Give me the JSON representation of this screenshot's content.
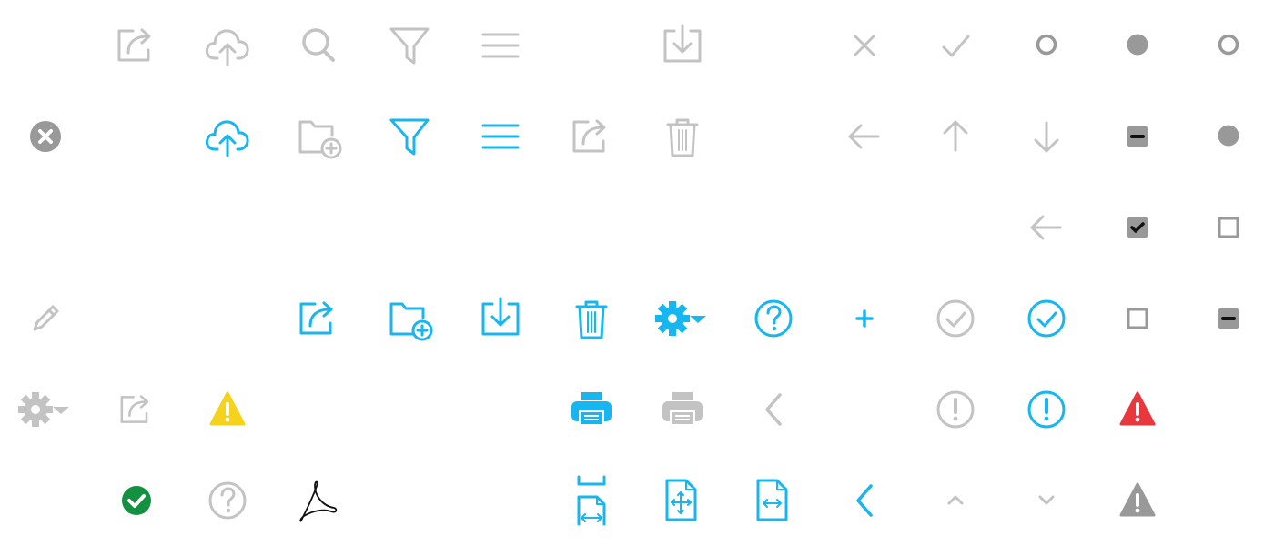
{
  "colors": {
    "gray": "#c3c3c3",
    "dark_gray": "#999999",
    "blue": "#18b6f0",
    "black": "#111111",
    "yellow": "#f5d31c",
    "red": "#e8383d",
    "green": "#149140",
    "white": "#ffffff"
  },
  "icons": [
    {
      "name": "share-icon",
      "tone": "gray"
    },
    {
      "name": "cloud-upload-icon",
      "tone": "gray"
    },
    {
      "name": "search-icon",
      "tone": "gray"
    },
    {
      "name": "filter-icon",
      "tone": "gray"
    },
    {
      "name": "menu-icon",
      "tone": "gray"
    },
    {
      "name": "download-icon",
      "tone": "gray"
    },
    {
      "name": "close-icon",
      "tone": "gray"
    },
    {
      "name": "check-icon",
      "tone": "gray"
    },
    {
      "name": "radio-unselected-icon",
      "tone": "dark_gray"
    },
    {
      "name": "dot-filled-icon",
      "tone": "dark_gray"
    },
    {
      "name": "radio-unselected-icon",
      "tone": "dark_gray"
    },
    {
      "name": "close-circle-icon",
      "tone": "dark_gray"
    },
    {
      "name": "cloud-upload-icon",
      "tone": "blue"
    },
    {
      "name": "folder-add-icon",
      "tone": "gray"
    },
    {
      "name": "filter-icon",
      "tone": "blue"
    },
    {
      "name": "menu-icon",
      "tone": "blue"
    },
    {
      "name": "share-icon",
      "tone": "gray"
    },
    {
      "name": "trash-icon",
      "tone": "gray"
    },
    {
      "name": "arrow-left-icon",
      "tone": "gray"
    },
    {
      "name": "arrow-up-icon",
      "tone": "gray"
    },
    {
      "name": "arrow-down-icon",
      "tone": "gray"
    },
    {
      "name": "checkbox-indeterminate-icon",
      "tone": "dark_gray"
    },
    {
      "name": "dot-filled-icon",
      "tone": "dark_gray"
    },
    {
      "name": "arrow-left-icon",
      "tone": "gray"
    },
    {
      "name": "checkbox-checked-icon",
      "tone": "dark_gray"
    },
    {
      "name": "checkbox-empty-icon",
      "tone": "dark_gray"
    },
    {
      "name": "pencil-icon",
      "tone": "gray"
    },
    {
      "name": "share-icon",
      "tone": "blue"
    },
    {
      "name": "folder-add-icon",
      "tone": "blue"
    },
    {
      "name": "download-icon",
      "tone": "blue"
    },
    {
      "name": "trash-icon",
      "tone": "blue"
    },
    {
      "name": "gear-dropdown-icon",
      "tone": "blue"
    },
    {
      "name": "help-circle-icon",
      "tone": "blue"
    },
    {
      "name": "plus-icon",
      "tone": "blue"
    },
    {
      "name": "check-circle-icon",
      "tone": "gray"
    },
    {
      "name": "check-circle-icon",
      "tone": "blue"
    },
    {
      "name": "checkbox-empty-icon",
      "tone": "dark_gray"
    },
    {
      "name": "checkbox-indeterminate-icon",
      "tone": "dark_gray"
    },
    {
      "name": "gear-dropdown-icon",
      "tone": "gray"
    },
    {
      "name": "share-icon",
      "tone": "gray"
    },
    {
      "name": "warning-icon",
      "tone": "yellow"
    },
    {
      "name": "printer-icon",
      "tone": "blue"
    },
    {
      "name": "printer-icon",
      "tone": "gray"
    },
    {
      "name": "chevron-left-icon",
      "tone": "gray"
    },
    {
      "name": "exclamation-circle-icon",
      "tone": "gray"
    },
    {
      "name": "exclamation-circle-icon",
      "tone": "blue"
    },
    {
      "name": "warning-icon",
      "tone": "red"
    },
    {
      "name": "check-circle-filled-icon",
      "tone": "green"
    },
    {
      "name": "help-circle-icon",
      "tone": "gray"
    },
    {
      "name": "pdf-icon",
      "tone": "black"
    },
    {
      "name": "fit-page-icon",
      "tone": "blue"
    },
    {
      "name": "fit-page-all-icon",
      "tone": "blue"
    },
    {
      "name": "fit-width-icon",
      "tone": "blue"
    },
    {
      "name": "chevron-left-icon",
      "tone": "blue"
    },
    {
      "name": "chevron-up-icon",
      "tone": "gray"
    },
    {
      "name": "chevron-down-icon",
      "tone": "gray"
    },
    {
      "name": "warning-icon",
      "tone": "dark_gray"
    }
  ]
}
